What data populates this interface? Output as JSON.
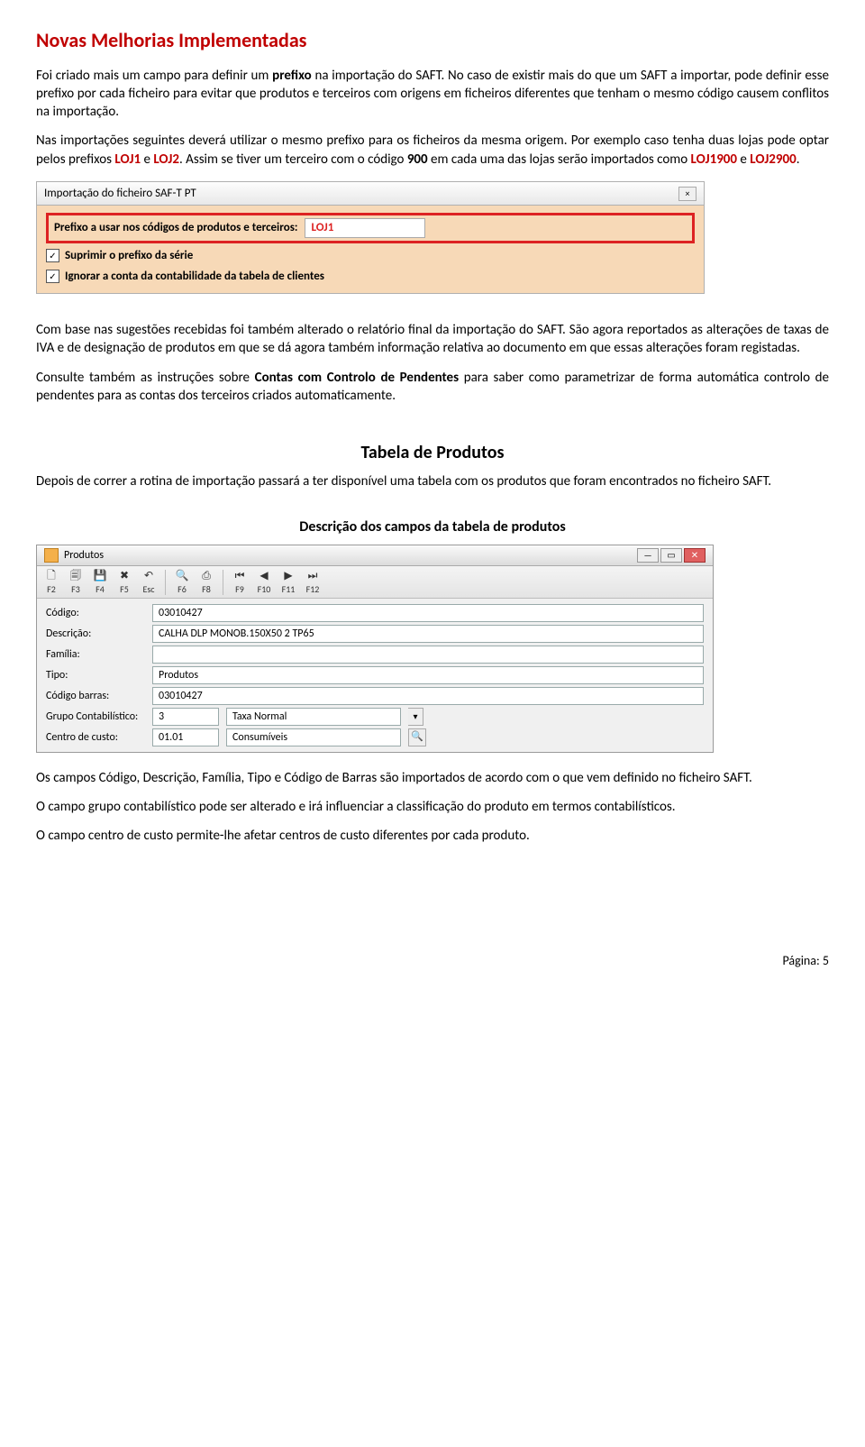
{
  "title": "Novas Melhorias Implementadas",
  "p1_a": "Foi criado mais um campo para definir um ",
  "p1_b": "prefixo",
  "p1_c": " na importação do SAFT. No caso de existir mais do que um SAFT a importar, pode definir esse prefixo por cada ficheiro para evitar que produtos e terceiros com origens em ficheiros diferentes que tenham o mesmo código causem conflitos na importação.",
  "p2_a": "Nas importações seguintes deverá utilizar o mesmo prefixo para os ficheiros da mesma origem. Por exemplo caso tenha duas lojas pode optar pelos prefixos ",
  "p2_l1": "LOJ1",
  "p2_b": " e ",
  "p2_l2": "LOJ2",
  "p2_c": ". Assim se tiver um terceiro com o código ",
  "p2_d": "900",
  "p2_e": " em cada uma das lojas serão importados como ",
  "p2_l3": "LOJ1900",
  "p2_f": " e ",
  "p2_l4": "LOJ2900",
  "p2_g": ".",
  "dlg1": {
    "title": "Importação do ficheiro SAF-T PT",
    "prefix_label": "Prefixo a usar nos códigos de produtos e terceiros:",
    "prefix_value": "LOJ1",
    "opt1": "Suprimir o prefixo da série",
    "opt2": "Ignorar a conta da contabilidade da tabela de clientes",
    "close": "×"
  },
  "p3": "Com base nas sugestões recebidas foi também alterado o relatório final da importação do SAFT. São agora reportados as alterações de taxas de IVA e de designação de produtos em que se dá agora também informação relativa ao documento em que essas alterações foram registadas.",
  "p4_a": "Consulte também as instruções sobre ",
  "p4_b": "Contas com Controlo de Pendentes",
  "p4_c": " para saber como parametrizar de forma automática controlo de pendentes para as contas dos terceiros criados automaticamente.",
  "h2": "Tabela de Produtos",
  "p5": "Depois de correr a rotina de importação passará a ter disponível uma tabela com os produtos que foram encontrados no ficheiro SAFT.",
  "h3": "Descrição dos campos da tabela de produtos",
  "dlg2": {
    "title": "Produtos",
    "tb": [
      "F2",
      "F3",
      "F4",
      "F5",
      "Esc",
      "F6",
      "F8",
      "F9",
      "F10",
      "F11",
      "F12"
    ],
    "rows": {
      "codigo_l": "Código:",
      "codigo_v": "03010427",
      "desc_l": "Descrição:",
      "desc_v": "CALHA DLP MONOB.150X50 2 TP65",
      "fam_l": "Família:",
      "fam_v": "",
      "tipo_l": "Tipo:",
      "tipo_v": "Produtos",
      "codb_l": "Código barras:",
      "codb_v": "03010427",
      "grp_l": "Grupo Contabilístico:",
      "grp_v1": "3",
      "grp_v2": "Taxa Normal",
      "cc_l": "Centro de custo:",
      "cc_v1": "01.01",
      "cc_v2": "Consumíveis"
    }
  },
  "p6": "Os campos Código, Descrição, Família, Tipo e Código de Barras são importados de acordo com o que vem definido no ficheiro SAFT.",
  "p7": "O campo grupo contabilístico pode ser alterado e irá influenciar a classificação do produto em termos contabilísticos.",
  "p8": "O campo centro de custo permite-lhe afetar centros de custo diferentes por cada produto.",
  "footer": "Página: 5"
}
